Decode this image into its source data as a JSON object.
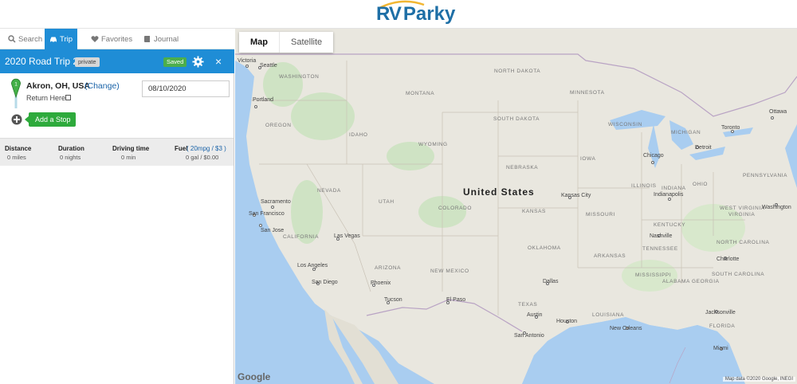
{
  "brand": {
    "logo_rv": "RV",
    "logo_parky": "Parky"
  },
  "tabs": [
    {
      "label": "Search",
      "icon": "search-icon"
    },
    {
      "label": "Trip",
      "icon": "car-icon",
      "active": true
    },
    {
      "label": "Favorites",
      "icon": "heart-icon"
    },
    {
      "label": "Journal",
      "icon": "book-icon"
    }
  ],
  "trip": {
    "title": "2020 Road Trip 2",
    "privacy": "private",
    "status": "Saved",
    "close_glyph": "×"
  },
  "stop": {
    "name": "Akron, OH, USA",
    "change_label": "(Change)",
    "return_label": "Return Here",
    "date_value": "08/10/2020",
    "pin_number": "1",
    "add_stop_label": "Add a Stop"
  },
  "stats": {
    "distance_label": "Distance",
    "distance_value": "0 miles",
    "duration_label": "Duration",
    "duration_value": "0 nights",
    "driving_label": "Driving time",
    "driving_value": "0 min",
    "fuel_label": "Fuel",
    "fuel_options": "( 20mpg / $3 )",
    "fuel_value": "0 gal / $0.00"
  },
  "map": {
    "type_map": "Map",
    "type_satellite": "Satellite",
    "country_label": "United States",
    "google_label": "Google",
    "attribution": "Map data ©2020 Google, INEGI",
    "colors": {
      "water": "#a9cdf0",
      "land": "#e9e7df",
      "park": "#cfe3c4",
      "border": "#b9a3c4",
      "accent": "#1f8dd6",
      "success": "#2eaa3c"
    },
    "states": [
      "WASHINGTON",
      "OREGON",
      "IDAHO",
      "MONTANA",
      "NORTH DAKOTA",
      "SOUTH DAKOTA",
      "MINNESOTA",
      "WYOMING",
      "NEVADA",
      "UTAH",
      "COLORADO",
      "NEBRASKA",
      "IOWA",
      "KANSAS",
      "MISSOURI",
      "ILLINOIS",
      "INDIANA",
      "OHIO",
      "CALIFORNIA",
      "ARIZONA",
      "NEW MEXICO",
      "OKLAHOMA",
      "ARKANSAS",
      "TEXAS",
      "MISSISSIPPI",
      "GEORGIA",
      "WISCONSIN",
      "MICHIGAN",
      "KENTUCKY",
      "TENNESSEE",
      "NORTH CAROLINA",
      "SOUTH CAROLINA",
      "ALABAMA",
      "VIRGINIA",
      "WEST VIRGINIA",
      "PENNSYLVANIA",
      "LOUISIANA",
      "FLORIDA"
    ],
    "cities": [
      "Victoria",
      "Seattle",
      "Portland",
      "Sacramento",
      "San Francisco",
      "San Jose",
      "Las Vegas",
      "Los Angeles",
      "San Diego",
      "Phoenix",
      "Tucson",
      "El Paso",
      "Dallas",
      "Austin",
      "Houston",
      "San Antonio",
      "New Orleans",
      "Kansas City",
      "Chicago",
      "Detroit",
      "Indianapolis",
      "Nashville",
      "Charlotte",
      "Jacksonville",
      "Miami",
      "Toronto",
      "Ottawa",
      "Washington"
    ]
  }
}
